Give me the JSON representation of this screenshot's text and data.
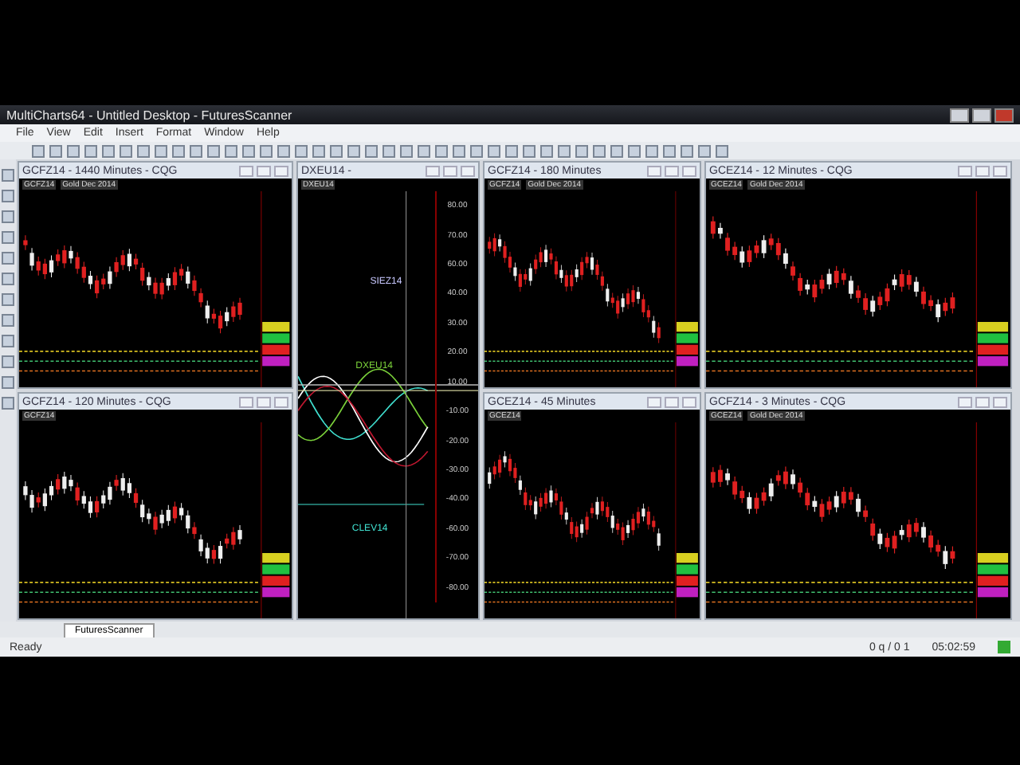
{
  "window": {
    "title": "MultiCharts64 - Untitled Desktop - FuturesScanner"
  },
  "menu": [
    "File",
    "View",
    "Edit",
    "Insert",
    "Format",
    "Window",
    "Help"
  ],
  "panels": [
    {
      "kind": "candles",
      "title": "GCFZ14 - 1440 Minutes - CQG",
      "symbol": "GCFZ14",
      "description": "Gold Dec 2014"
    },
    {
      "kind": "spread",
      "title": "DXEU14 -",
      "symbol": "DXEU14",
      "labels": [
        {
          "text": "SIEZ14",
          "color": "#c8c8ff"
        },
        {
          "text": "DXEU14",
          "color": "#7ad03a"
        },
        {
          "text": "CLEV14",
          "color": "#40e0d0"
        }
      ],
      "axis": [
        "80.00",
        "70.00",
        "60.00",
        "40.00",
        "30.00",
        "20.00",
        "10.00",
        "-10.00",
        "-20.00",
        "-30.00",
        "-40.00",
        "-60.00",
        "-70.00",
        "-80.00"
      ]
    },
    {
      "kind": "candles",
      "title": "GCFZ14 - 180 Minutes",
      "symbol": "GCFZ14",
      "description": "Gold Dec 2014"
    },
    {
      "kind": "candles",
      "title": "GCEZ14 - 12 Minutes - CQG",
      "symbol": "GCEZ14",
      "description": "Gold Dec 2014"
    },
    {
      "kind": "candles",
      "title": "GCFZ14 - 120 Minutes - CQG",
      "symbol": "GCFZ14"
    },
    {
      "kind": "candles",
      "title": "GCEZ14 - 45 Minutes",
      "symbol": "GCEZ14"
    },
    {
      "kind": "candles",
      "title": "GCFZ14 - 3 Minutes - CQG",
      "symbol": "GCEZ14",
      "description": "Gold Dec 2014"
    }
  ],
  "tabs": [
    {
      "label": "FuturesScanner",
      "selected": true
    }
  ],
  "status_bar": {
    "message": "Ready",
    "quotes": "0 q / 0 1",
    "time": "05:02:59"
  }
}
